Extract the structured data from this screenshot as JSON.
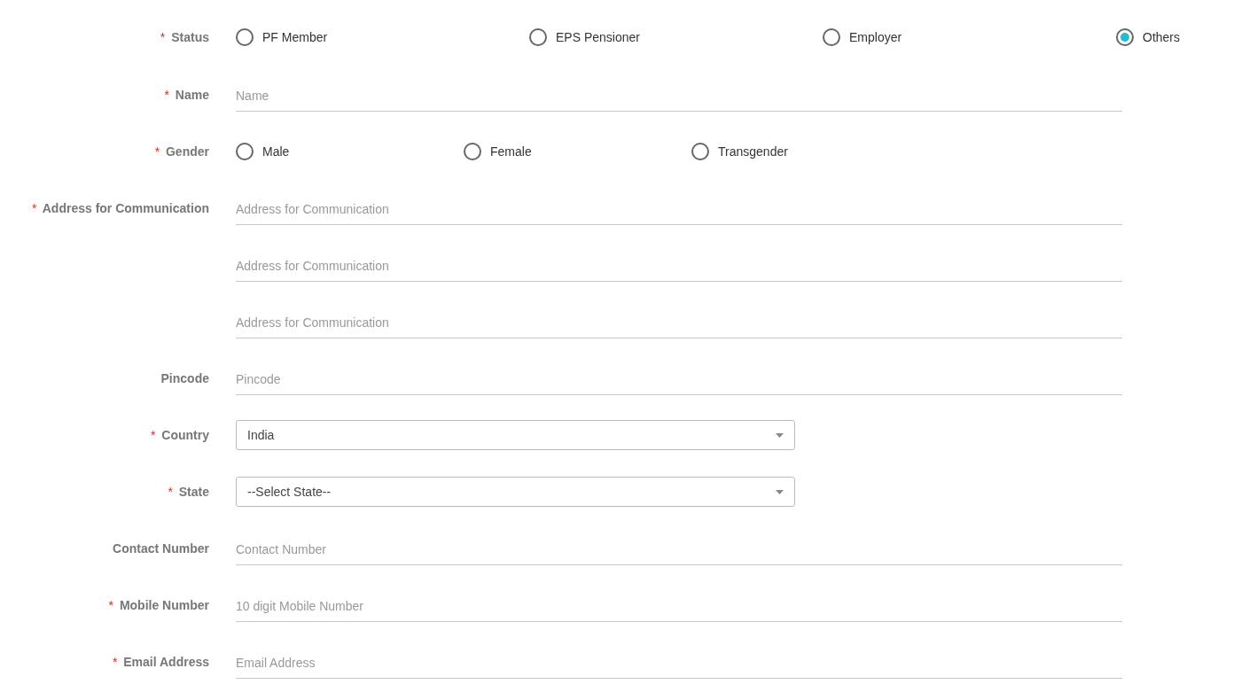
{
  "fields": [
    {
      "label": "Status",
      "marker": "*",
      "kind": "radio",
      "options": [
        {
          "label": "PF Member",
          "selected": false
        },
        {
          "label": "EPS Pensioner",
          "selected": false
        },
        {
          "label": "Employer",
          "selected": false
        },
        {
          "label": "Others",
          "selected": true
        }
      ]
    },
    {
      "label": "Name",
      "marker": "*",
      "kind": "text",
      "placeholders": [
        "Name"
      ]
    },
    {
      "label": "Gender",
      "marker": "*",
      "kind": "radio",
      "options": [
        {
          "label": "Male",
          "selected": false
        },
        {
          "label": "Female",
          "selected": false
        },
        {
          "label": "Transgender",
          "selected": false
        }
      ]
    },
    {
      "label": "Address for Communication",
      "marker": "*",
      "kind": "text",
      "placeholders": [
        "Address for Communication",
        "Address for Communication",
        "Address for Communication"
      ]
    },
    {
      "label": "Pincode",
      "kind": "text",
      "placeholders": [
        "Pincode"
      ]
    },
    {
      "label": "Country",
      "marker": "*",
      "kind": "select",
      "value": "India"
    },
    {
      "label": "State",
      "marker": "*",
      "kind": "select",
      "value": "--Select State--"
    },
    {
      "label": "Contact Number",
      "kind": "text",
      "placeholders": [
        "Contact Number"
      ]
    },
    {
      "label": "Mobile Number",
      "marker": "*",
      "kind": "text",
      "placeholders": [
        "10 digit Mobile Number"
      ]
    },
    {
      "label": "Email Address",
      "marker": "*",
      "kind": "text",
      "placeholders": [
        "Email Address"
      ]
    }
  ]
}
